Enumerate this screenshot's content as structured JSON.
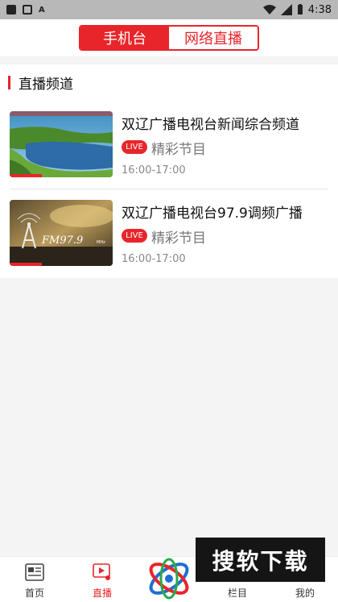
{
  "status_bar": {
    "time": "4:38"
  },
  "header": {
    "tabs": [
      {
        "label": "手机台",
        "active": true
      },
      {
        "label": "网络直播",
        "active": false
      }
    ]
  },
  "section": {
    "title": "直播频道",
    "channels": [
      {
        "title": "双辽广播电视台新闻综合频道",
        "badge": "LIVE",
        "tag": "精彩节目",
        "time": "16:00-17:00"
      },
      {
        "title": "双辽广播电视台97.9调频广播",
        "badge": "LIVE",
        "tag": "精彩节目",
        "time": "16:00-17:00"
      }
    ]
  },
  "bottom_nav": {
    "items": [
      {
        "label": "首页",
        "icon": "newspaper-icon",
        "active": false
      },
      {
        "label": "直播",
        "icon": "video-play-icon",
        "active": true
      },
      {
        "label": "栏目",
        "icon": "columns-icon",
        "active": false
      },
      {
        "label": "我的",
        "icon": "user-icon",
        "active": false
      }
    ]
  },
  "watermark": {
    "text": "搜软下载"
  },
  "colors": {
    "accent": "#e8252a",
    "background": "#f4f4f4"
  }
}
